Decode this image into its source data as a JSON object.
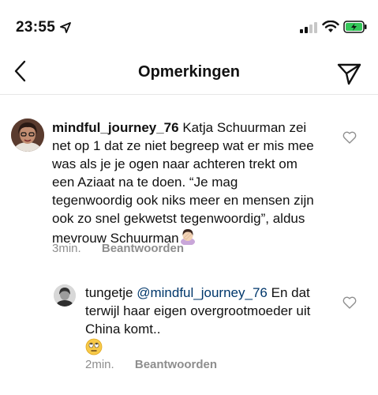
{
  "status_bar": {
    "time": "23:55"
  },
  "header": {
    "title": "Opmerkingen"
  },
  "comments": [
    {
      "username": "mindful_journey_76",
      "text": "Katja Schuurman zei net op 1 dat ze  niet begreep wat er mis mee was als je je ogen naar achteren trekt om een Aziaat na te doen. “Je mag tegenwoordig ook niks meer en mensen zijn ook zo snel gekwetst tegenwoordig”, aldus mevrouw Schuurman",
      "emoji": "woman-facepalming",
      "time_ago": "3min.",
      "reply_label": "Beantwoorden"
    }
  ],
  "replies": [
    {
      "username": "tungetje",
      "mention": "@mindful_journey_76",
      "text": "En dat terwijl haar eigen overgrootmoeder uit China komt..",
      "emoji": "face-with-rolling-eyes",
      "time_ago": "2min.",
      "reply_label": "Beantwoorden"
    }
  ],
  "colors": {
    "mention": "#00376b",
    "meta_gray": "#8e8e8e",
    "battery_green": "#34c759"
  }
}
